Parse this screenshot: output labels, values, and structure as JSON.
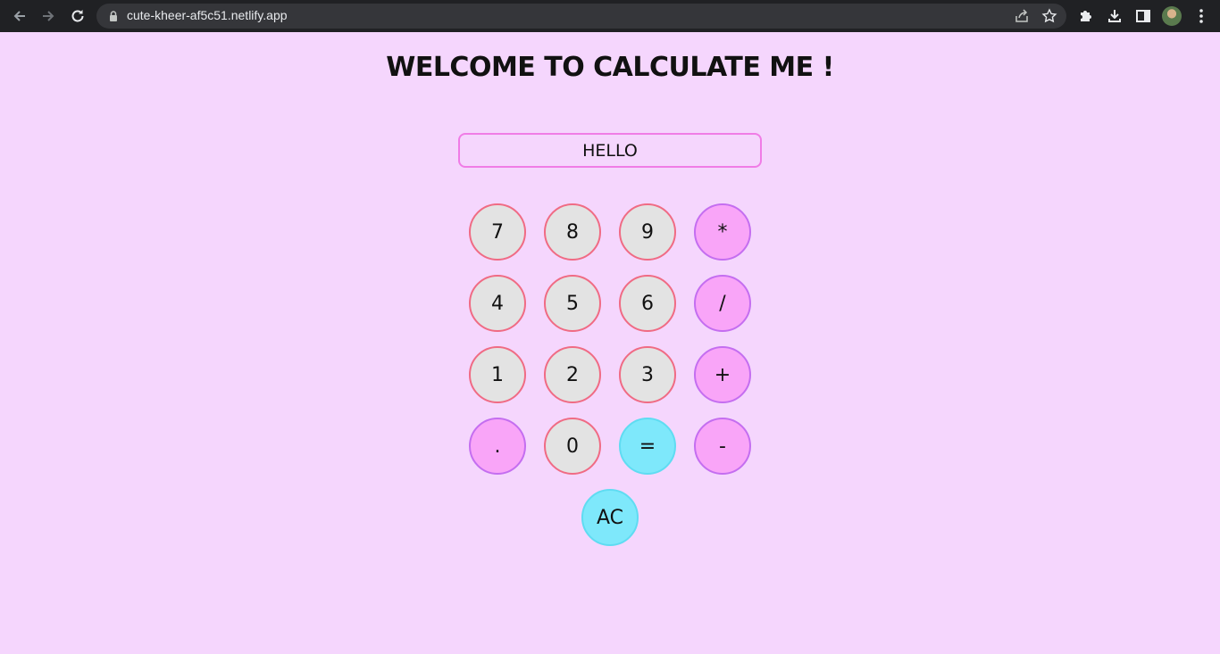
{
  "browser": {
    "url": "cute-kheer-af5c51.netlify.app",
    "icons": [
      "back-arrow-icon",
      "forward-arrow-icon",
      "reload-icon",
      "lock-icon",
      "share-icon",
      "bookmark-star-icon",
      "extensions-puzzle-icon",
      "download-icon",
      "side-panel-icon",
      "profile-avatar",
      "menu-kebab-icon"
    ]
  },
  "page": {
    "title": "WELCOME TO CALCULATE ME !",
    "display_value": "HELLO"
  },
  "keypad": {
    "k7": "7",
    "k8": "8",
    "k9": "9",
    "mul": "*",
    "k4": "4",
    "k5": "5",
    "k6": "6",
    "div": "/",
    "k1": "1",
    "k2": "2",
    "k3": "3",
    "add": "+",
    "dot": ".",
    "k0": "0",
    "eq": "=",
    "sub": "-",
    "ac": "AC"
  },
  "colors": {
    "page_background": "#f5d6fd",
    "number_key_fill": "#e3e3e3",
    "number_key_border": "#f06b84",
    "operator_key_fill": "#f9a5f8",
    "operator_key_border": "#c46ef0",
    "action_key_fill": "#7ee8fb",
    "display_border": "#f07ce6"
  }
}
